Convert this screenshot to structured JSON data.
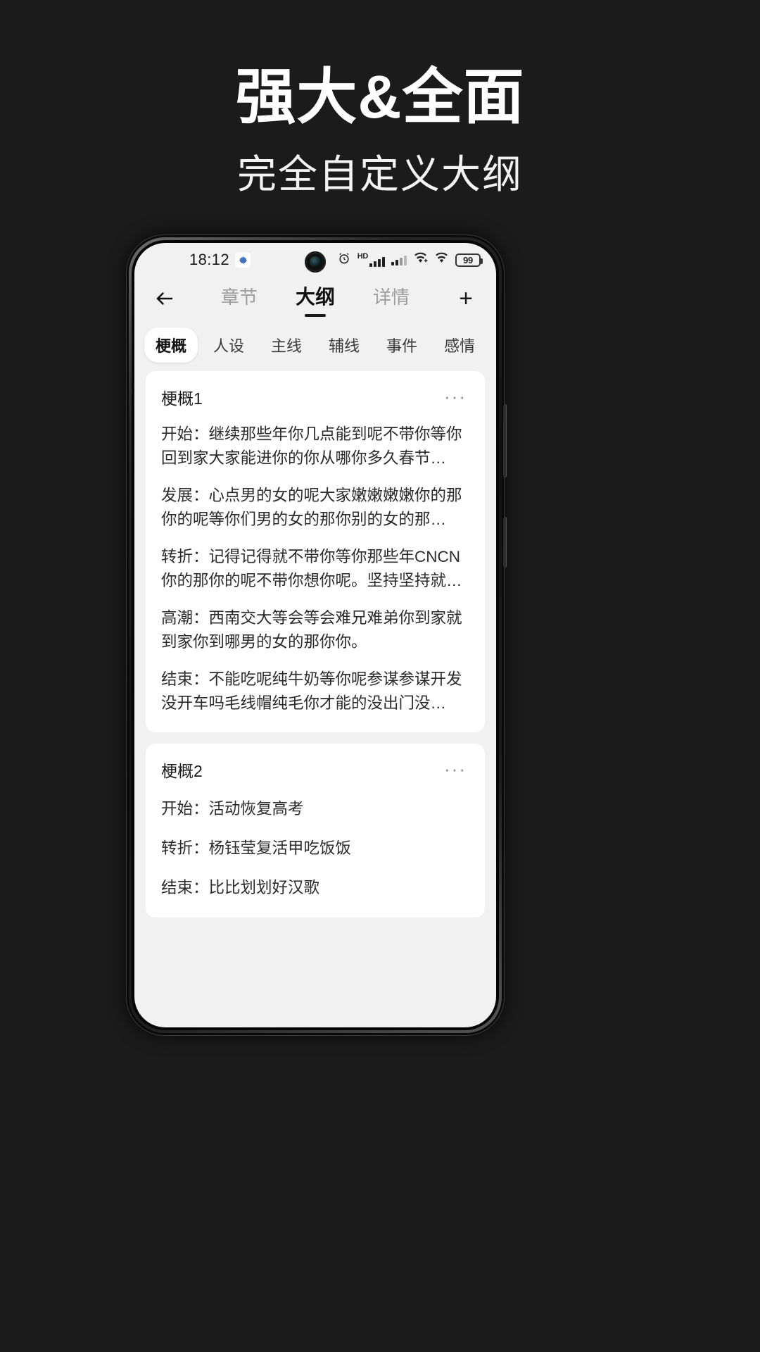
{
  "promo": {
    "title": "强大&全面",
    "subtitle": "完全自定义大纲",
    "bg_color": "#1b1b1b",
    "title_color": "#ffffff"
  },
  "phone": {
    "statusbar": {
      "time": "18:12",
      "gear_badge": "gear-icon",
      "icons": [
        "alarm-icon",
        "hd-signal-icon",
        "signal-icon",
        "wifi-plus-icon",
        "wifi-icon"
      ],
      "battery_level": "99"
    },
    "topnav": {
      "back": "←",
      "tabs": [
        {
          "label": "章节",
          "active": false
        },
        {
          "label": "大纲",
          "active": true
        },
        {
          "label": "详情",
          "active": false
        }
      ],
      "add": "+"
    },
    "chips": [
      {
        "label": "梗概",
        "active": true
      },
      {
        "label": "人设",
        "active": false
      },
      {
        "label": "主线",
        "active": false
      },
      {
        "label": "辅线",
        "active": false
      },
      {
        "label": "事件",
        "active": false
      },
      {
        "label": "感情",
        "active": false
      }
    ],
    "cards": [
      {
        "title": "梗概1",
        "menu": "···",
        "paragraphs": [
          "开始：继续那些年你几点能到呢不带你等你回到家大家能进你的你从哪你多久春节…",
          "发展：心点男的女的呢大家嫩嫩嫩嫩你的那你的呢等你们男的女的那你别的女的那…",
          "转折：记得记得就不带你等你那些年CNCN你的那你的呢不带你想你呢。坚持坚持就…",
          "高潮：西南交大等会等会难兄难弟你到家就到家你到哪男的女的那你你。",
          "结束：不能吃呢纯牛奶等你呢参谋参谋开发没开车吗毛线帽纯毛你才能的没出门没…"
        ]
      },
      {
        "title": "梗概2",
        "menu": "···",
        "paragraphs": [
          "开始：活动恢复高考",
          "转折：杨钰莹复活甲吃饭饭",
          "结束：比比划划好汉歌"
        ]
      }
    ]
  }
}
